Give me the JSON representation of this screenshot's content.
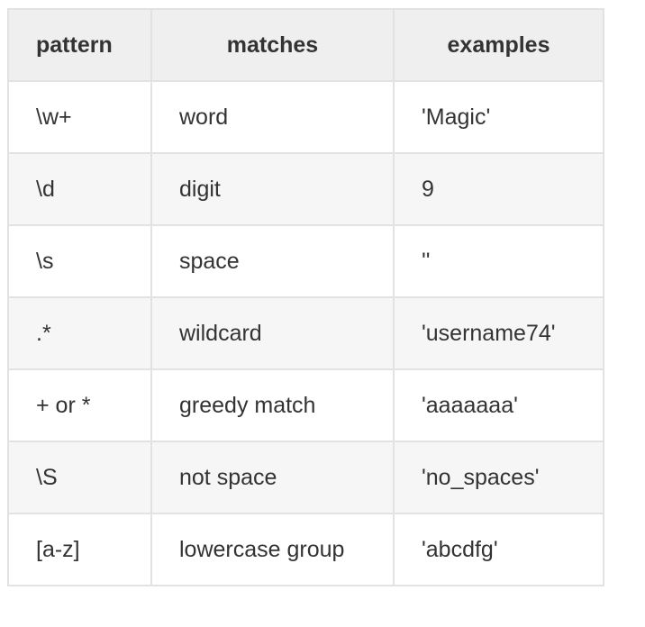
{
  "table": {
    "headers": [
      "pattern",
      "matches",
      "examples"
    ],
    "rows": [
      {
        "pattern": "\\w+",
        "matches": "word",
        "examples": "'Magic'"
      },
      {
        "pattern": "\\d",
        "matches": "digit",
        "examples": "9"
      },
      {
        "pattern": "\\s",
        "matches": "space",
        "examples": "''"
      },
      {
        "pattern": ".*",
        "matches": "wildcard",
        "examples": "'username74'"
      },
      {
        "pattern": "+ or *",
        "matches": "greedy match",
        "examples": "'aaaaaaa'"
      },
      {
        "pattern": "\\S",
        "matches": "not space",
        "examples": "'no_spaces'"
      },
      {
        "pattern": "[a-z]",
        "matches": "lowercase group",
        "examples": "'abcdfg'"
      }
    ]
  }
}
